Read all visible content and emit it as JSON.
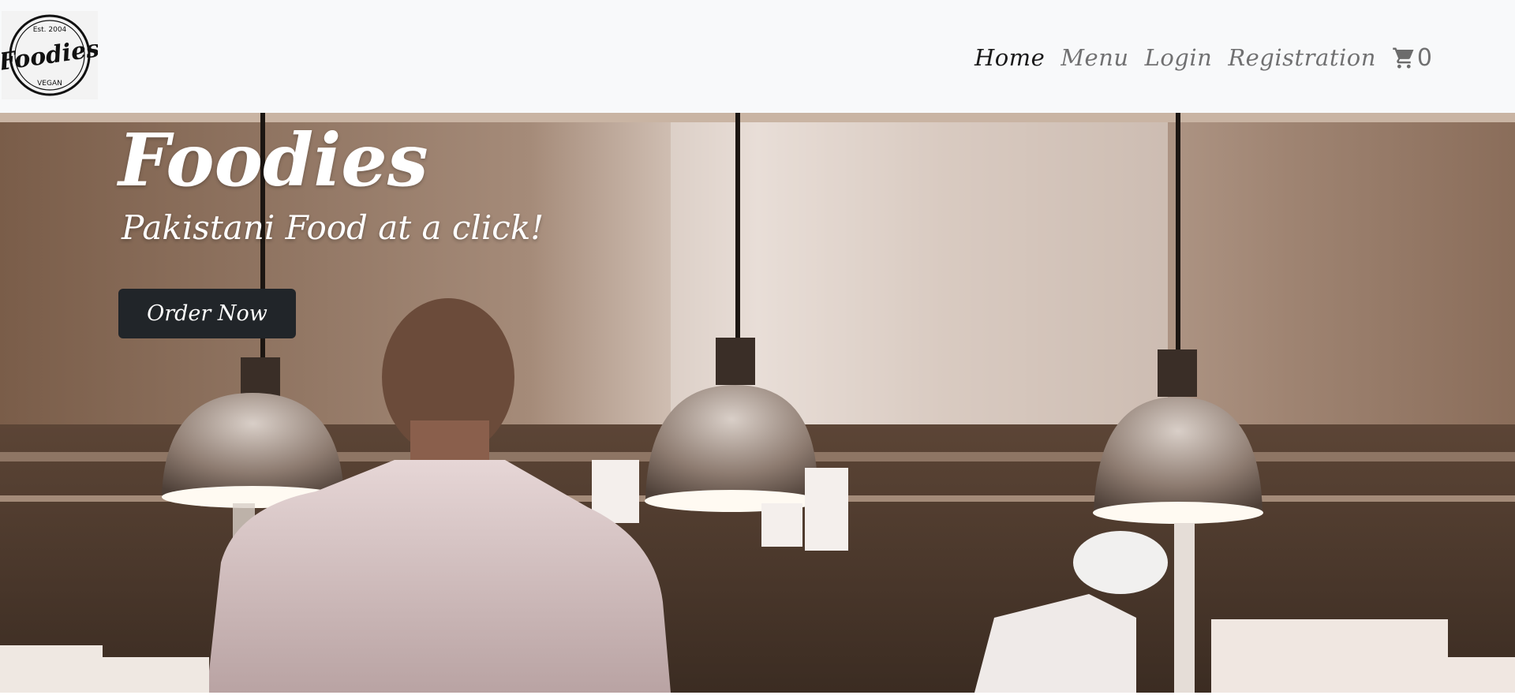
{
  "brand": {
    "logo_text": "Foodies",
    "logo_est": "Est. 2004",
    "logo_tag": "VEGAN"
  },
  "nav": {
    "items": [
      {
        "label": "Home",
        "active": true
      },
      {
        "label": "Menu",
        "active": false
      },
      {
        "label": "Login",
        "active": false
      },
      {
        "label": "Registration",
        "active": false
      }
    ],
    "cart": {
      "icon": "cart-icon",
      "count": "0"
    }
  },
  "hero": {
    "title": "Foodies",
    "subtitle": "Pakistani Food at a click!",
    "cta_label": "Order Now"
  },
  "colors": {
    "navbar_bg": "#f8f9fa",
    "button_bg": "#212529",
    "hero_text": "#ffffff"
  }
}
